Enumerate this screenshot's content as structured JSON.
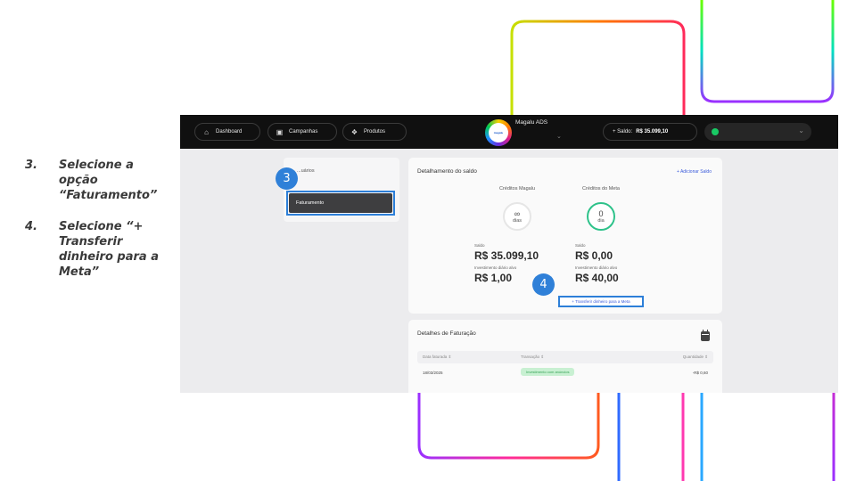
{
  "instructions": [
    {
      "number": "3.",
      "text": "Selecione a opção “Faturamento”"
    },
    {
      "number": "4.",
      "text": "Selecione “+ Transferir dinheiro para a Meta”"
    }
  ],
  "topbar": {
    "nav": [
      {
        "label": "Dashboard",
        "icon": "home-icon"
      },
      {
        "label": "Campanhas",
        "icon": "briefcase-icon"
      },
      {
        "label": "Produtos",
        "icon": "box-icon"
      }
    ],
    "brand_name": "Magalu ADS",
    "logo_text": "magalu",
    "saldo_prefix": "+ Saldo:",
    "saldo_value": "R$ 35.099,10"
  },
  "sidebar": {
    "items": [
      {
        "label": "...uários"
      },
      {
        "label": "Faturamento",
        "selected": true
      }
    ]
  },
  "callouts": {
    "step3": "3",
    "step4": "4"
  },
  "balance": {
    "title": "Detalhamento do saldo",
    "add_link": "+ Adicionar Saldo",
    "magalu": {
      "title": "Créditos Magalu",
      "ring_value": "∞",
      "ring_unit": "dias",
      "saldo_label": "Saldo",
      "saldo_value": "R$ 35.099,10",
      "invest_label": "Investimento diário alvo",
      "invest_value": "R$ 1,00"
    },
    "meta": {
      "title": "Créditos do Meta",
      "ring_value": "0",
      "ring_unit": "dia",
      "saldo_label": "Saldo",
      "saldo_value": "R$ 0,00",
      "invest_label": "Investimento diário alvo",
      "invest_value": "R$ 40,00"
    },
    "transfer_button": "+ Transferir dinheiro para a Meta"
  },
  "billing": {
    "title": "Detalhes de Faturação",
    "columns": [
      "Data faturada ⇕",
      "Transação ⇕",
      "Quantidade ⇕"
    ],
    "rows": [
      {
        "date": "18/03/2025",
        "transaction": "Investimento com anúncios",
        "amount": "-R$ 0,60"
      }
    ]
  },
  "colors": {
    "accent_blue": "#2d7fd8",
    "topbar": "#101010",
    "status_green": "#18c964"
  }
}
